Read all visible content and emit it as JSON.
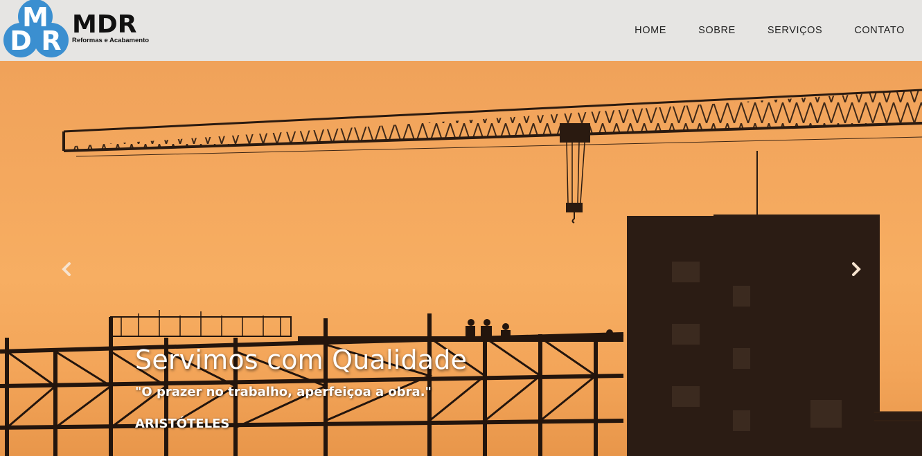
{
  "brand": {
    "logo_letters": [
      "M",
      "D",
      "R"
    ],
    "name": "MDR",
    "tagline": "Reformas e Acabamento",
    "logo_color": "#3b8fd0"
  },
  "nav": {
    "items": [
      {
        "label": "HOME"
      },
      {
        "label": "SOBRE"
      },
      {
        "label": "SERVIÇOS"
      },
      {
        "label": "CONTATO"
      }
    ]
  },
  "hero": {
    "title": "Servimos com Qualidade",
    "quote": "\"O prazer no trabalho, aperfeiçoa a obra.\"",
    "author": "ARISTÓTELES",
    "prev_icon": "chevron-left-icon",
    "next_icon": "chevron-right-icon"
  }
}
